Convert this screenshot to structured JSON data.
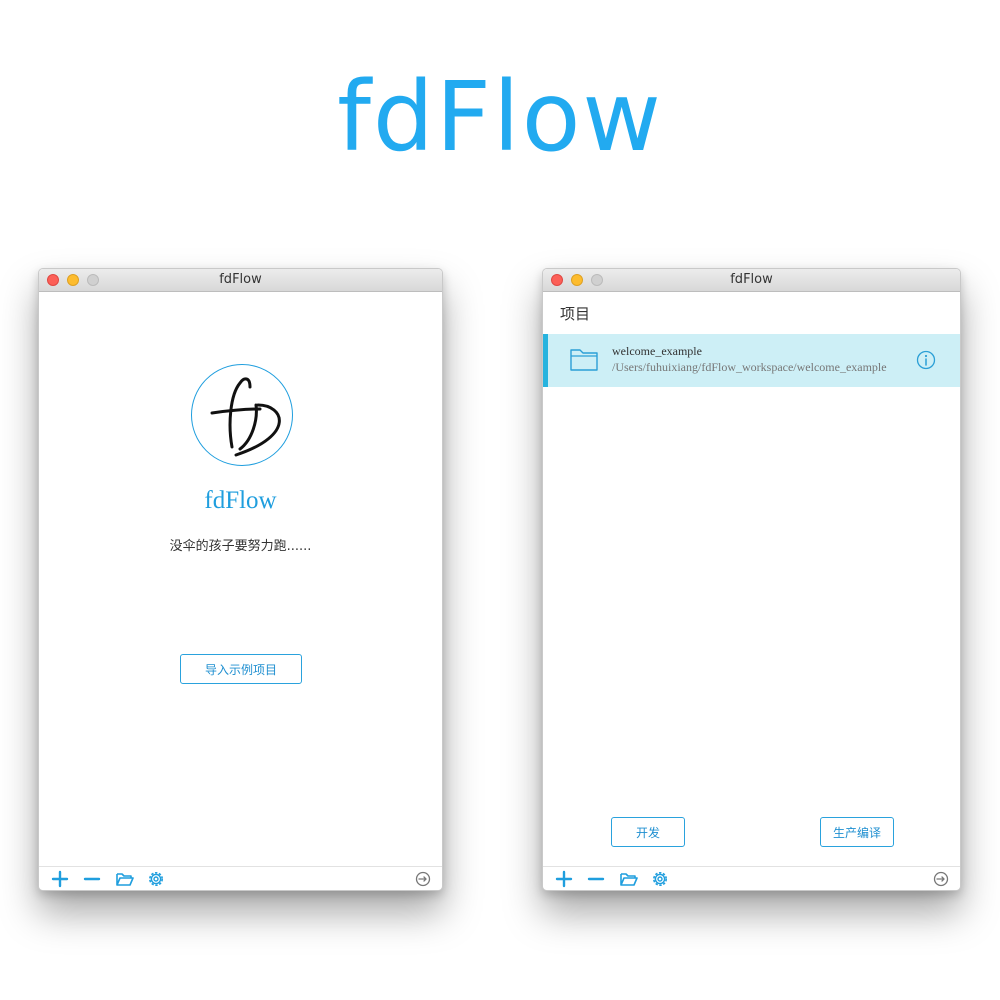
{
  "hero": {
    "title": "fdFlow"
  },
  "welcome_window": {
    "title": "fdFlow",
    "logo_icon": "fd-handwritten-logo",
    "app_name": "fdFlow",
    "slogan": "没伞的孩子要努力跑......",
    "import_button": "导入示例项目"
  },
  "projects_window": {
    "title": "fdFlow",
    "section_title": "项目",
    "projects": [
      {
        "name": "welcome_example",
        "path": "/Users/fuhuixiang/fdFlow_workspace/welcome_example",
        "icon": "folder-icon",
        "selected": true
      }
    ],
    "dev_button": "开发",
    "build_button": "生产编译"
  },
  "toolbar": {
    "icons": [
      "plus-icon",
      "minus-icon",
      "folder-open-icon",
      "gear-icon",
      "sync-icon"
    ]
  },
  "colors": {
    "accent": "#22aaf0",
    "selected_row": "#cdeff6",
    "selected_bar": "#27b3de"
  }
}
